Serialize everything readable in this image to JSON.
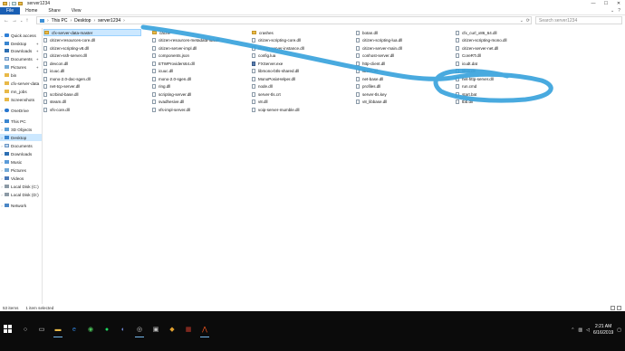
{
  "window": {
    "title": "server1234",
    "tabs": [
      "File",
      "Home",
      "Share",
      "View"
    ]
  },
  "address": {
    "crumbs": [
      "This PC",
      "Desktop",
      "server1234"
    ],
    "search_placeholder": "Search server1234"
  },
  "nav_pane": {
    "quick_access": "Quick access",
    "quick_items": [
      "Desktop",
      "Downloads",
      "Documents",
      "Pictures",
      "bin",
      "cfx-server-data",
      "mn_jobs",
      "Screenshots"
    ],
    "onedrive": "OneDrive",
    "this_pc": "This PC",
    "pc_items": [
      "3D Objects",
      "Desktop",
      "Documents",
      "Downloads",
      "Music",
      "Pictures",
      "Videos",
      "Local Disk (C:)",
      "Local Disk (D:)"
    ],
    "network": "Network"
  },
  "files": {
    "col1": [
      "cfx-server-data-master",
      "citizen-resources-core.dll",
      "citizen-scripting-v8.dll",
      "citizen-ssh-server.dll",
      "devcon.dll",
      "icuuc.dll",
      "mono-2.0-dac-sgen.dll",
      "net-tcp-server.dll",
      "scrbind-base.dll",
      "steam.dll",
      "vfs-core.dll"
    ],
    "col2": [
      "cache",
      "citizen-resources-metadata-lua.dll",
      "citizen-server-impl.dll",
      "components.json",
      "ETWProviders64.dll",
      "icuuc.dll",
      "mono-2.0-sgen.dll",
      "ring.dll",
      "scripting-server.dll",
      "svadhesive.dll",
      "vfs-impl-server.dll"
    ],
    "col3": [
      "crashes",
      "citizen-scripting-core.dll",
      "citizen-server-instance.dll",
      "config.lua",
      "FXServer.exe",
      "libmono-btls-shared.dll",
      "MonoPosixHelper.dll",
      "node.dll",
      "server-tls.crt",
      "v8.dll",
      "voip-server-mumble.dll"
    ],
    "col4": [
      "botan.dll",
      "citizen-scripting-lua.dll",
      "citizen-server-main.dll",
      "conhost-server.dll",
      "http-client.dll",
      "libssh.dll",
      "net-base.dll",
      "profiles.dll",
      "server-tls.key",
      "v8_libbase.dll"
    ],
    "col5": [
      "cfx_curl_x86_64.dll",
      "citizen-scripting-mono.dll",
      "citizen-server-net.dll",
      "CoreRT.dll",
      "icudt.dat",
      "libuv.dll",
      "net-http-server.dll",
      "run.cmd",
      "start.bat",
      "tbb.dll"
    ]
  },
  "status": {
    "count": "53 items",
    "selected": "1 item selected"
  },
  "taskbar": {
    "time": "2:21 AM",
    "date": "6/16/2019"
  },
  "colors": {
    "selection": "#cce8ff",
    "file_tab": "#1a5fb4",
    "annotation": "#3aa3dc",
    "taskbar": "#0b0b0b"
  }
}
